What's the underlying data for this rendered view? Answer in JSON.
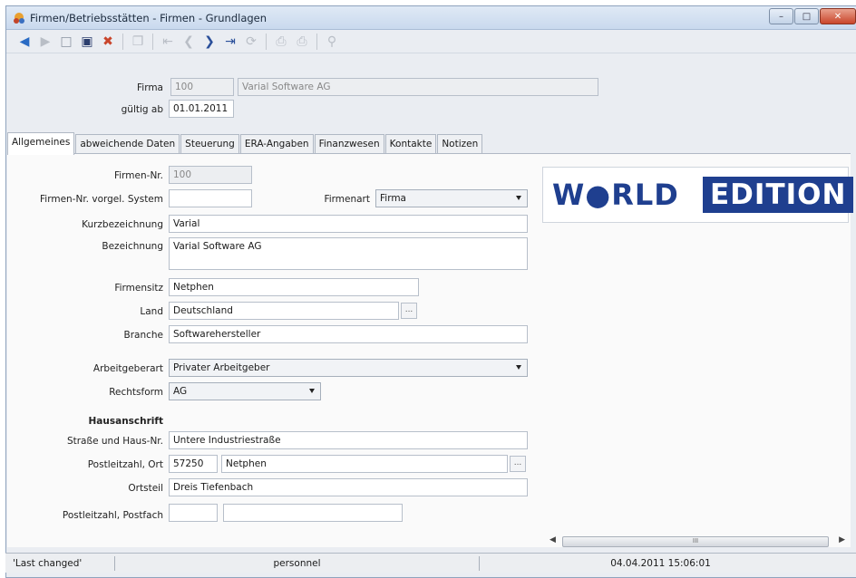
{
  "window": {
    "title": "Firmen/Betriebsstätten - Firmen - Grundlagen",
    "buttons": {
      "minimize": "–",
      "maximize": "□",
      "close": "✕"
    }
  },
  "toolbar": {
    "icons": [
      "back-icon",
      "forward-icon",
      "new-document-icon",
      "save-icon",
      "cancel-icon",
      "copy-icon",
      "first-record-icon",
      "previous-record-icon",
      "next-record-icon",
      "last-record-icon",
      "refresh-icon",
      "print-icon",
      "print-preview-icon",
      "search-icon"
    ]
  },
  "header": {
    "firma_label": "Firma",
    "firma_number": "100",
    "firma_name": "Varial Software AG",
    "gueltig_label": "gültig ab",
    "gueltig_value": "01.01.2011"
  },
  "tabs": [
    {
      "label": "Allgemeines",
      "active": true
    },
    {
      "label": "abweichende Daten",
      "active": false
    },
    {
      "label": "Steuerung",
      "active": false
    },
    {
      "label": "ERA-Angaben",
      "active": false
    },
    {
      "label": "Finanzwesen",
      "active": false
    },
    {
      "label": "Kontakte",
      "active": false
    },
    {
      "label": "Notizen",
      "active": false
    }
  ],
  "form": {
    "firmen_nr_label": "Firmen-Nr.",
    "firmen_nr_value": "100",
    "vorgel_label": "Firmen-Nr. vorgel. System",
    "vorgel_value": "",
    "firmenart_label": "Firmenart",
    "firmenart_value": "Firma",
    "kurz_label": "Kurzbezeichnung",
    "kurz_value": "Varial",
    "bez_label": "Bezeichnung",
    "bez_value": "Varial Software AG",
    "sitz_label": "Firmensitz",
    "sitz_value": "Netphen",
    "land_label": "Land",
    "land_value": "Deutschland",
    "branche_label": "Branche",
    "branche_value": "Softwarehersteller",
    "arbeitgeberart_label": "Arbeitgeberart",
    "arbeitgeberart_value": "Privater Arbeitgeber",
    "rechtsform_label": "Rechtsform",
    "rechtsform_value": "AG",
    "hausanschrift_heading": "Hausanschrift",
    "strasse_label": "Straße und Haus-Nr.",
    "strasse_value": "Untere Industriestraße",
    "plz_ort_label": "Postleitzahl, Ort",
    "plz_value": "57250",
    "ort_value": "Netphen",
    "ortsteil_label": "Ortsteil",
    "ortsteil_value": "Dreis Tiefenbach",
    "postfach_label": "Postleitzahl, Postfach",
    "postfach_plz_value": "",
    "postfach_value": "",
    "lookup_button": "..."
  },
  "logo": {
    "word": "W●RLD",
    "edition": "EDITION"
  },
  "scrollbar": {
    "grip": "III"
  },
  "status": {
    "last_changed": "'Last changed'",
    "user": "personnel",
    "timestamp": "04.04.2011 15:06:01"
  },
  "colors": {
    "brand_blue": "#1f3f8f",
    "title_bar": "#c9d9ee",
    "close_red": "#c9452b"
  }
}
